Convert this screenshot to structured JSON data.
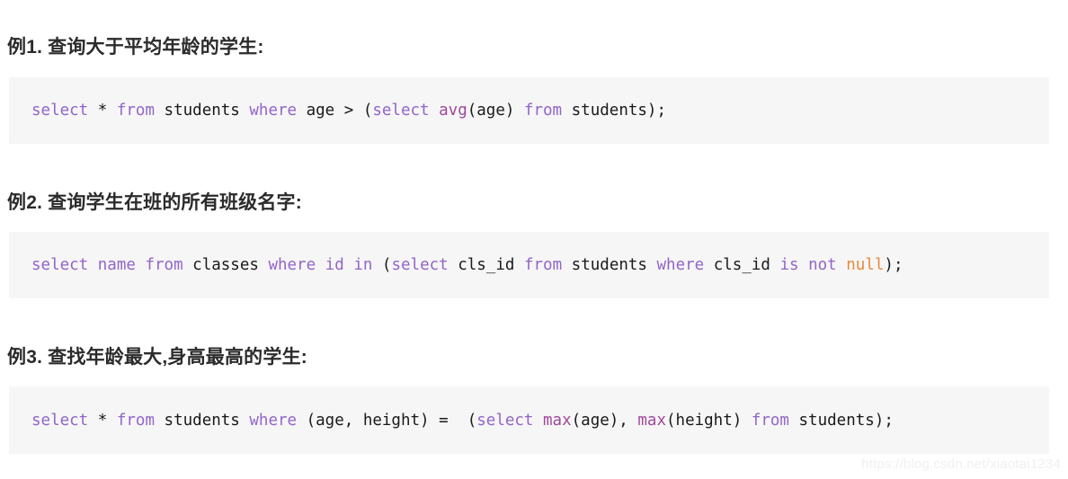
{
  "document": {
    "background_color": "#ffffff",
    "code_block_background": "#f6f6f6",
    "heading_color": "#2b2b2b",
    "keyword_color": "#9265c9",
    "function_color": "#a0479a",
    "constant_color": "#e8883a",
    "identifier_color": "#1a1a1a"
  },
  "sections": [
    {
      "heading": "例1. 查询大于平均年龄的学生:",
      "code_text": "select * from students where age > (select avg(age) from students);",
      "tokens": [
        {
          "text": "select",
          "type": "kw"
        },
        {
          "text": " ",
          "type": "plain"
        },
        {
          "text": "*",
          "type": "plain"
        },
        {
          "text": " ",
          "type": "plain"
        },
        {
          "text": "from",
          "type": "kw"
        },
        {
          "text": " students ",
          "type": "plain"
        },
        {
          "text": "where",
          "type": "kw"
        },
        {
          "text": " age > (",
          "type": "plain"
        },
        {
          "text": "select",
          "type": "kw"
        },
        {
          "text": " ",
          "type": "plain"
        },
        {
          "text": "avg",
          "type": "fn"
        },
        {
          "text": "(age) ",
          "type": "plain"
        },
        {
          "text": "from",
          "type": "kw"
        },
        {
          "text": " students);",
          "type": "plain"
        }
      ]
    },
    {
      "heading": "例2. 查询学生在班的所有班级名字:",
      "code_text": "select name from classes where id in (select cls_id from students where cls_id is not null);",
      "tokens": [
        {
          "text": "select",
          "type": "kw"
        },
        {
          "text": " ",
          "type": "plain"
        },
        {
          "text": "name",
          "type": "kw"
        },
        {
          "text": " ",
          "type": "plain"
        },
        {
          "text": "from",
          "type": "kw"
        },
        {
          "text": " classes ",
          "type": "plain"
        },
        {
          "text": "where",
          "type": "kw"
        },
        {
          "text": " ",
          "type": "plain"
        },
        {
          "text": "id",
          "type": "kw"
        },
        {
          "text": " ",
          "type": "plain"
        },
        {
          "text": "in",
          "type": "kw"
        },
        {
          "text": " (",
          "type": "plain"
        },
        {
          "text": "select",
          "type": "kw"
        },
        {
          "text": " cls_id ",
          "type": "plain"
        },
        {
          "text": "from",
          "type": "kw"
        },
        {
          "text": " students ",
          "type": "plain"
        },
        {
          "text": "where",
          "type": "kw"
        },
        {
          "text": " cls_id ",
          "type": "plain"
        },
        {
          "text": "is",
          "type": "kw"
        },
        {
          "text": " ",
          "type": "plain"
        },
        {
          "text": "not",
          "type": "kw"
        },
        {
          "text": " ",
          "type": "plain"
        },
        {
          "text": "null",
          "type": "const"
        },
        {
          "text": ");",
          "type": "plain"
        }
      ]
    },
    {
      "heading": "例3. 查找年龄最大,身高最高的学生:",
      "code_text": "select * from students where (age, height) =  (select max(age), max(height) from students);",
      "tokens": [
        {
          "text": "select",
          "type": "kw"
        },
        {
          "text": " ",
          "type": "plain"
        },
        {
          "text": "*",
          "type": "plain"
        },
        {
          "text": " ",
          "type": "plain"
        },
        {
          "text": "from",
          "type": "kw"
        },
        {
          "text": " students ",
          "type": "plain"
        },
        {
          "text": "where",
          "type": "kw"
        },
        {
          "text": " (age, height) =  (",
          "type": "plain"
        },
        {
          "text": "select",
          "type": "kw"
        },
        {
          "text": " ",
          "type": "plain"
        },
        {
          "text": "max",
          "type": "fn"
        },
        {
          "text": "(age), ",
          "type": "plain"
        },
        {
          "text": "max",
          "type": "fn"
        },
        {
          "text": "(height) ",
          "type": "plain"
        },
        {
          "text": "from",
          "type": "kw"
        },
        {
          "text": " students);",
          "type": "plain"
        }
      ]
    }
  ],
  "watermark": {
    "text": "https://blog.csdn.net/xiaotai1234"
  }
}
